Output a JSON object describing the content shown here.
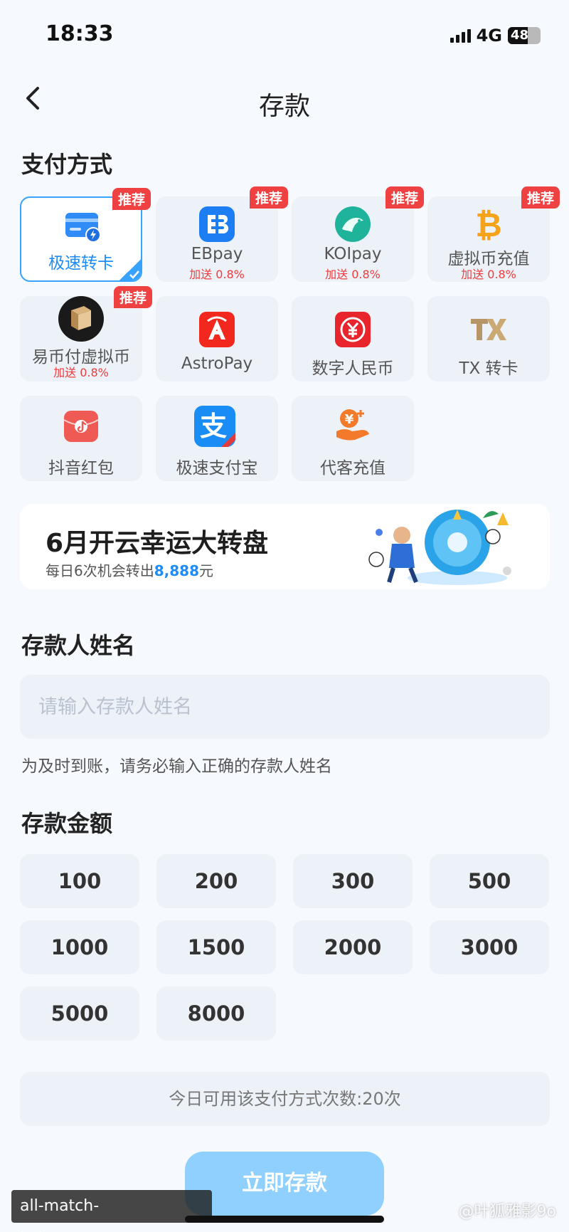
{
  "status": {
    "time": "18:33",
    "network": "4G",
    "battery": "48"
  },
  "header": {
    "title": "存款"
  },
  "payment": {
    "section_title": "支付方式",
    "methods": [
      {
        "label": "极速转卡",
        "badge": "推荐",
        "bonus": "",
        "selected": true,
        "icon": "card-icon"
      },
      {
        "label": "EBpay",
        "badge": "推荐",
        "bonus": "加送 0.8%",
        "icon": "ebpay-icon"
      },
      {
        "label": "KOIpay",
        "badge": "推荐",
        "bonus": "加送 0.8%",
        "icon": "koi-fish-icon"
      },
      {
        "label": "虚拟币充值",
        "badge": "推荐",
        "bonus": "加送 0.8%",
        "icon": "bitcoin-icon"
      },
      {
        "label": "易币付虚拟币",
        "badge": "推荐",
        "bonus": "加送 0.8%",
        "icon": "yibifu-icon"
      },
      {
        "label": "AstroPay",
        "badge": "",
        "bonus": "",
        "icon": "astropay-icon"
      },
      {
        "label": "数字人民币",
        "badge": "",
        "bonus": "",
        "icon": "digital-rmb-icon"
      },
      {
        "label": "TX 转卡",
        "badge": "",
        "bonus": "",
        "icon": "tx-icon"
      },
      {
        "label": "抖音红包",
        "badge": "",
        "bonus": "",
        "icon": "red-envelope-icon"
      },
      {
        "label": "极速支付宝",
        "badge": "",
        "bonus": "",
        "icon": "alipay-icon"
      },
      {
        "label": "代客充值",
        "badge": "",
        "bonus": "",
        "icon": "hand-coin-icon"
      }
    ]
  },
  "banner": {
    "title": "6月开云幸运大转盘",
    "sub_prefix": "每日6次机会转出",
    "sub_amount": "8,888",
    "sub_suffix": "元"
  },
  "depositor": {
    "section_title": "存款人姓名",
    "placeholder": "请输入存款人姓名",
    "value": "",
    "hint": "为及时到账，请务必输入正确的存款人姓名"
  },
  "amount": {
    "section_title": "存款金额",
    "options": [
      "100",
      "200",
      "300",
      "500",
      "1000",
      "1500",
      "2000",
      "3000",
      "5000",
      "8000"
    ]
  },
  "limit_text": "今日可用该支付方式次数:20次",
  "submit_label": "立即存款",
  "watermark": {
    "url": "all-match-kaiyun.com.cn",
    "handle": "@叶狐雅影9o"
  },
  "colors": {
    "accent": "#1d8cf8",
    "badge": "#ef4141",
    "button": "#8fd0ff"
  }
}
